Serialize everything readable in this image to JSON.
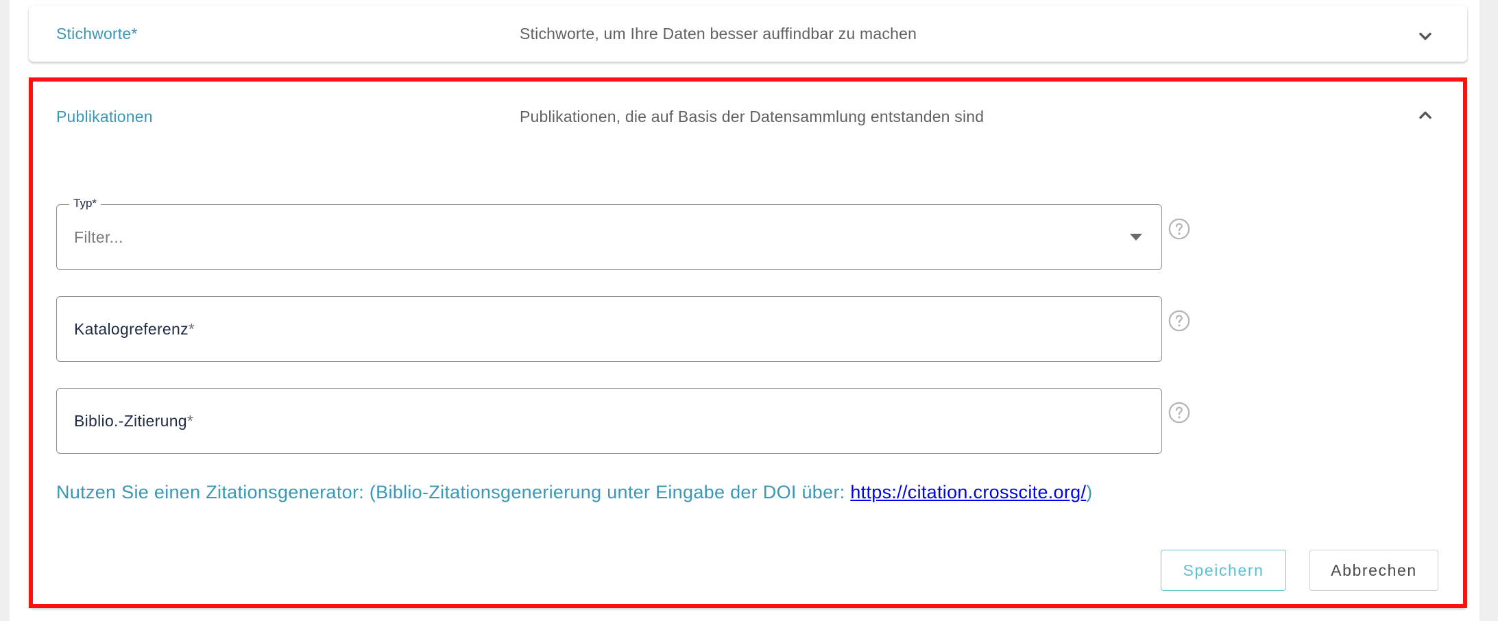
{
  "panels": {
    "stichworte": {
      "title": "Stichworte*",
      "description": "Stichworte, um Ihre Daten besser auffindbar zu machen",
      "expand_icon": "chevron-down-icon"
    },
    "publikationen": {
      "title": "Publikationen",
      "description": "Publikationen, die auf Basis der Datensammlung entstanden sind",
      "collapse_icon": "chevron-up-icon",
      "fields": {
        "typ": {
          "legend": "Typ*",
          "placeholder": "Filter...",
          "help_icon": "help-circle-icon"
        },
        "katalogreferenz": {
          "label": "Katalogreferenz",
          "required_mark": "*",
          "help_icon": "help-circle-icon"
        },
        "zitierung": {
          "label": "Biblio.-Zitierung",
          "required_mark": "*",
          "help_icon": "help-circle-icon"
        }
      },
      "hint": {
        "text": "Nutzen Sie einen Zitationsgenerator: (Biblio-Zitationsgenerierung unter Eingabe der DOI über: ",
        "link": "https://citation.crosscite.org/",
        "suffix": ")"
      },
      "buttons": {
        "save": "Speichern",
        "cancel": "Abbrechen"
      }
    }
  },
  "colors": {
    "accent": "#3a97b6",
    "highlight": "#ff1010",
    "save_button": "#5fbfd0",
    "link": "#0000ee"
  }
}
